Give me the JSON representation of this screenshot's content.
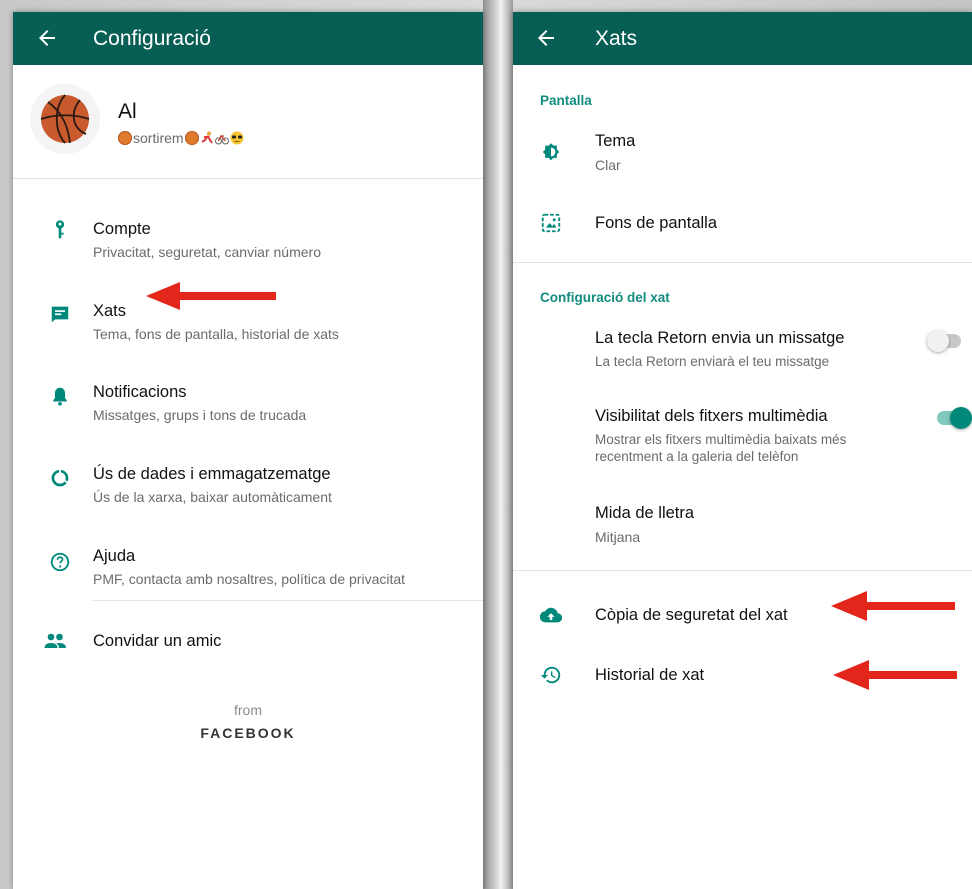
{
  "colors": {
    "header": "#075e54",
    "icon": "#00897b",
    "accent": "#128c7e",
    "arrow": "#e3261b"
  },
  "left": {
    "header": {
      "back_icon": "arrow-left-icon",
      "title": "Configuració"
    },
    "profile": {
      "name": "Al",
      "status_text": "sortirem"
    },
    "items": [
      {
        "icon": "key-icon",
        "title": "Compte",
        "subtitle": "Privacitat, seguretat, canviar número"
      },
      {
        "icon": "chat-icon",
        "title": "Xats",
        "subtitle": "Tema, fons de pantalla, historial de xats"
      },
      {
        "icon": "bell-icon",
        "title": "Notificacions",
        "subtitle": "Missatges, grups i tons de trucada"
      },
      {
        "icon": "data-usage-icon",
        "title": "Ús de dades i emmagatzematge",
        "subtitle": "Ús de la xarxa, baixar automàticament"
      },
      {
        "icon": "help-icon",
        "title": "Ajuda",
        "subtitle": "PMF, contacta amb nosaltres, política de privacitat"
      },
      {
        "icon": "people-icon",
        "title": "Convidar un amic"
      }
    ],
    "footer": {
      "from": "from",
      "brand": "FACEBOOK"
    }
  },
  "right": {
    "header": {
      "back_icon": "arrow-left-icon",
      "title": "Xats"
    },
    "sections": [
      {
        "heading": "Pantalla"
      },
      {
        "heading": "Configuració del xat"
      }
    ],
    "display": {
      "theme": {
        "icon": "brightness-icon",
        "title": "Tema",
        "subtitle": "Clar"
      },
      "wallpaper": {
        "icon": "wallpaper-icon",
        "title": "Fons de pantalla"
      }
    },
    "chat_settings": {
      "enter_send": {
        "title": "La tecla Retorn envia un missatge",
        "subtitle": "La tecla Retorn enviarà el teu missatge",
        "enabled": false
      },
      "media_visibility": {
        "title": "Visibilitat dels fitxers multimèdia",
        "subtitle_line1": "Mostrar els fitxers multimèdia baixats més",
        "subtitle_line2": "recentment a la galeria del telèfon",
        "enabled": true
      },
      "font_size": {
        "title": "Mida de lletra",
        "subtitle": "Mitjana"
      }
    },
    "backup": {
      "icon": "cloud-upload-icon",
      "title": "Còpia de seguretat del xat"
    },
    "history": {
      "icon": "history-icon",
      "title": "Historial de xat"
    }
  }
}
